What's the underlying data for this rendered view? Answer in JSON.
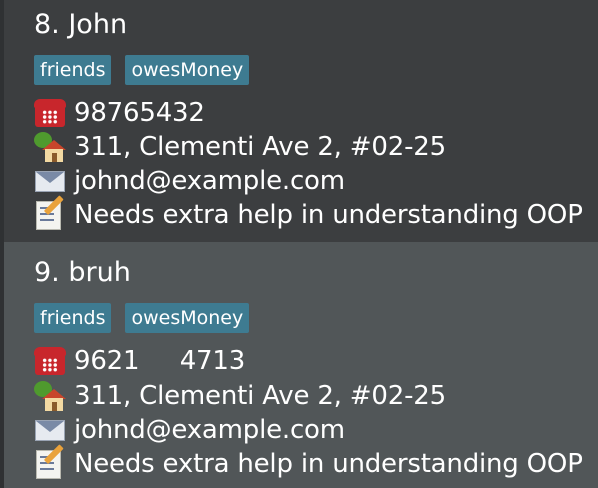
{
  "persons": [
    {
      "index_name": "8. John",
      "tags": [
        "friends",
        "owesMoney"
      ],
      "phone": "98765432",
      "address": "311, Clementi Ave 2, #02-25",
      "email": "johnd@example.com",
      "remark": "Needs extra help in understanding OOP",
      "icons": {
        "phone": "telephone-icon",
        "address": "house-icon",
        "email": "envelope-icon",
        "remark": "memo-icon"
      }
    },
    {
      "index_name": "9. bruh",
      "tags": [
        "friends",
        "owesMoney"
      ],
      "phone": "9621     4713",
      "address": "311, Clementi Ave 2, #02-25",
      "email": "johnd@example.com",
      "remark": "Needs extra help in understanding OOP",
      "icons": {
        "phone": "telephone-icon",
        "address": "house-icon",
        "email": "envelope-icon",
        "remark": "memo-icon"
      }
    }
  ],
  "colors": {
    "card_background": "#3c3e40",
    "selected_card_background": "#515658",
    "tag_background": "#3e7b91",
    "text": "#ffffff"
  }
}
